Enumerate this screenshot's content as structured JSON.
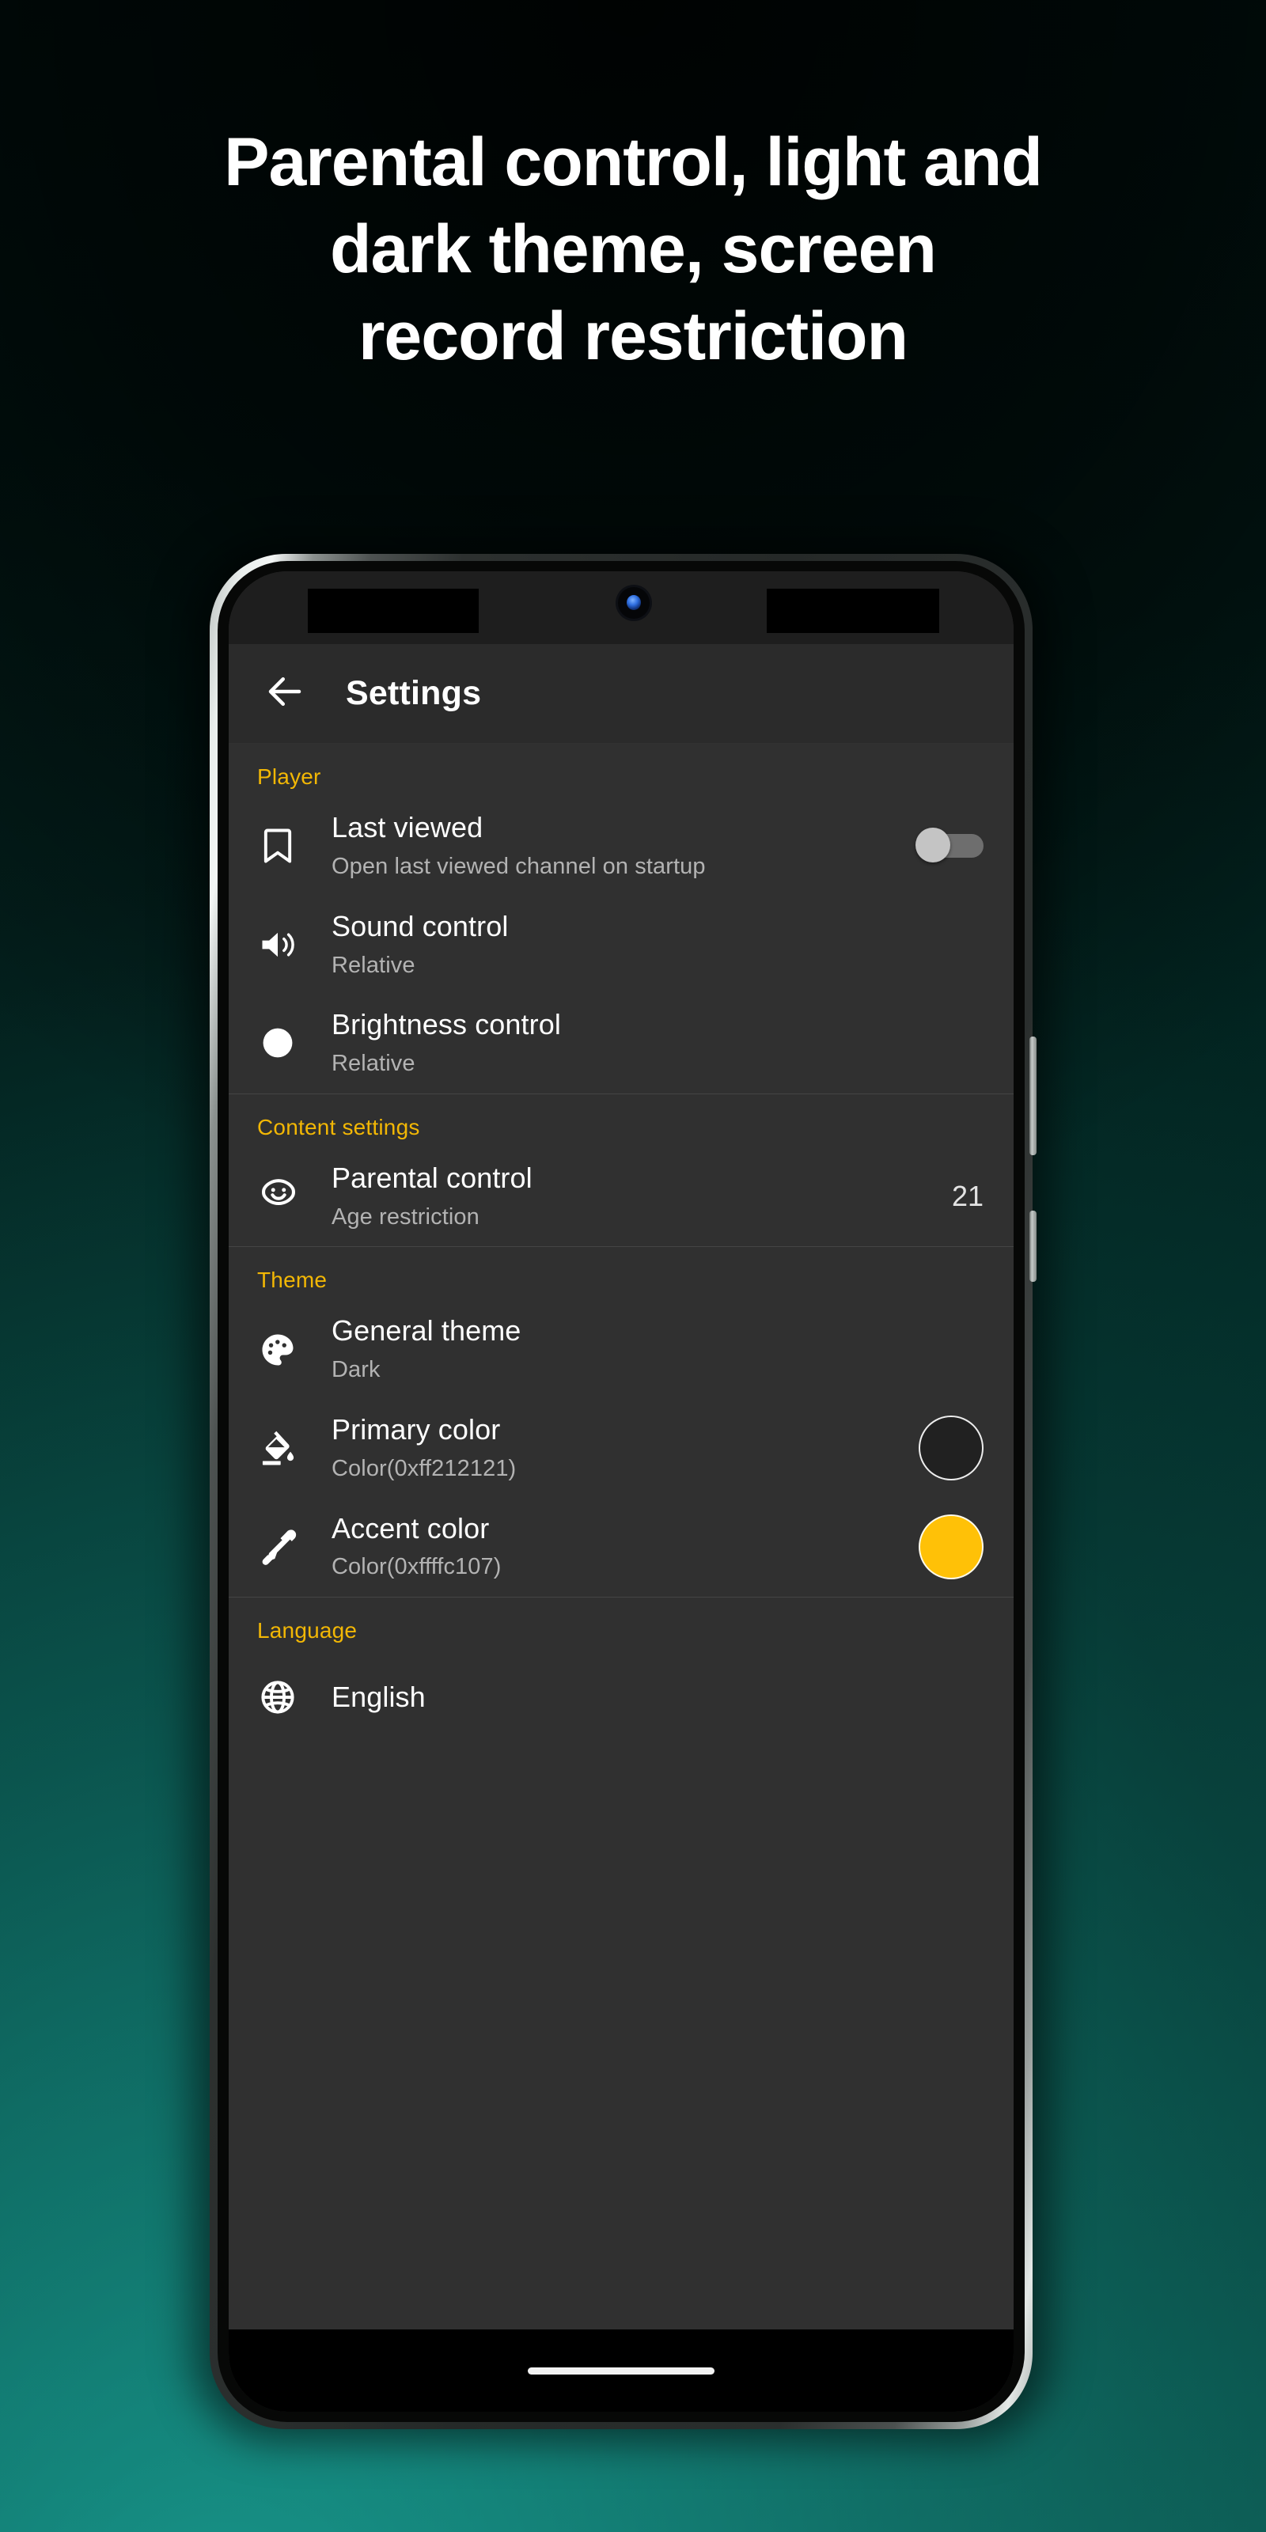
{
  "headline": {
    "lines": [
      "Parental control, light and",
      "dark theme, screen",
      "record restriction"
    ]
  },
  "colors": {
    "accent": "#ffc107",
    "section_header": "#f2b705",
    "screen_background": "#303030",
    "app_bar_background": "#2b2b2b",
    "status_bar_background": "#1e1e1e",
    "primary_swatch": "#212121",
    "accent_swatch": "#ffc107",
    "title_text": "#ffffff",
    "subtitle_text": "#b3b3b3"
  },
  "phone": {
    "status_bar": {
      "camera_icon": "punch-hole-camera"
    },
    "nav_bar": {
      "gesture_pill": "home-indicator"
    }
  },
  "app_bar": {
    "back_icon": "arrow-left-icon",
    "title": "Settings"
  },
  "sections": [
    {
      "id": "player",
      "header": "Player",
      "rows": [
        {
          "id": "last-viewed",
          "icon": "bookmark-icon",
          "title": "Last viewed",
          "subtitle": "Open last viewed channel on startup",
          "trailing_type": "switch",
          "switch_on": false
        },
        {
          "id": "sound-control",
          "icon": "volume-up-icon",
          "title": "Sound control",
          "subtitle": "Relative",
          "trailing_type": "none"
        },
        {
          "id": "brightness-control",
          "icon": "brightness-circle-icon",
          "title": "Brightness control",
          "subtitle": "Relative",
          "trailing_type": "none"
        }
      ]
    },
    {
      "id": "content-settings",
      "header": "Content settings",
      "rows": [
        {
          "id": "parental-control",
          "icon": "child-face-icon",
          "title": "Parental control",
          "subtitle": "Age restriction",
          "trailing_type": "value",
          "value": "21"
        }
      ]
    },
    {
      "id": "theme",
      "header": "Theme",
      "rows": [
        {
          "id": "general-theme",
          "icon": "palette-icon",
          "title": "General theme",
          "subtitle": "Dark",
          "trailing_type": "none"
        },
        {
          "id": "primary-color",
          "icon": "paint-bucket-icon",
          "title": "Primary color",
          "subtitle": "Color(0xff212121)",
          "trailing_type": "swatch",
          "swatch_color": "#212121"
        },
        {
          "id": "accent-color",
          "icon": "eyedropper-icon",
          "title": "Accent color",
          "subtitle": "Color(0xffffc107)",
          "trailing_type": "swatch",
          "swatch_color": "#ffc107"
        }
      ]
    },
    {
      "id": "language",
      "header": "Language",
      "rows": [
        {
          "id": "language-english",
          "icon": "globe-icon",
          "title": "English",
          "subtitle": "",
          "trailing_type": "none"
        }
      ]
    }
  ]
}
